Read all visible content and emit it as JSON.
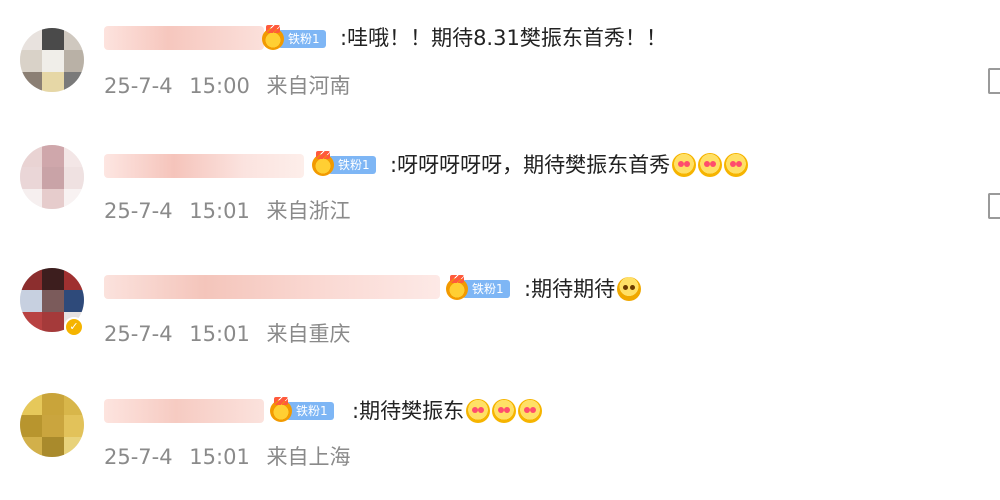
{
  "comments": [
    {
      "fan_badge": "铁粉1",
      "text": ":哇哦！！期待8.31樊振东首秀！！",
      "emojis": [],
      "date": "25-7-4",
      "time": "15:00",
      "location": "来自河南",
      "avatar_colors": [
        "#e8e2de",
        "#4a4a4a",
        "#cfc8bf",
        "#d9d2c8",
        "#f0eee9",
        "#b9b1a6",
        "#8b7f74",
        "#e6d7a6",
        "#7a7a7a"
      ],
      "name_color": "#f7c9c0"
    },
    {
      "fan_badge": "铁粉1",
      "text": ":呀呀呀呀呀，期待樊振东首秀",
      "emojis": [
        "hearts-face-icon",
        "hearts-face-icon",
        "hearts-face-icon"
      ],
      "date": "25-7-4",
      "time": "15:01",
      "location": "来自浙江",
      "avatar_colors": [
        "#e9d3d3",
        "#cfa7ab",
        "#f3e6e6",
        "#ead6d7",
        "#c9a3a7",
        "#efe1e1",
        "#f6efef",
        "#e6cccc",
        "#f8f2f2"
      ],
      "name_color": "#f6cfc9"
    },
    {
      "fan_badge": "铁粉1",
      "text": ":期待期待",
      "emojis": [
        "pray-face-icon"
      ],
      "date": "25-7-4",
      "time": "15:01",
      "location": "来自重庆",
      "avatar_colors": [
        "#8c2e2e",
        "#3d1e1e",
        "#9f3030",
        "#c7d0e0",
        "#7b5b5b",
        "#2e4a7a",
        "#b84242",
        "#a53a3a",
        "#e7e2e2"
      ],
      "name_color": "#f5c8bd"
    },
    {
      "fan_badge": "铁粉1",
      "text": ":期待樊振东",
      "emojis": [
        "hearts-face-icon",
        "hearts-face-icon",
        "hearts-face-icon"
      ],
      "date": "25-7-4",
      "time": "15:01",
      "location": "来自上海",
      "avatar_colors": [
        "#e6c85a",
        "#c9a43a",
        "#d8b64a",
        "#b8952e",
        "#caa53e",
        "#e2c25a",
        "#d2b04a",
        "#a98a2c",
        "#e8d27a"
      ],
      "name_color": "#f8d3cb"
    }
  ]
}
